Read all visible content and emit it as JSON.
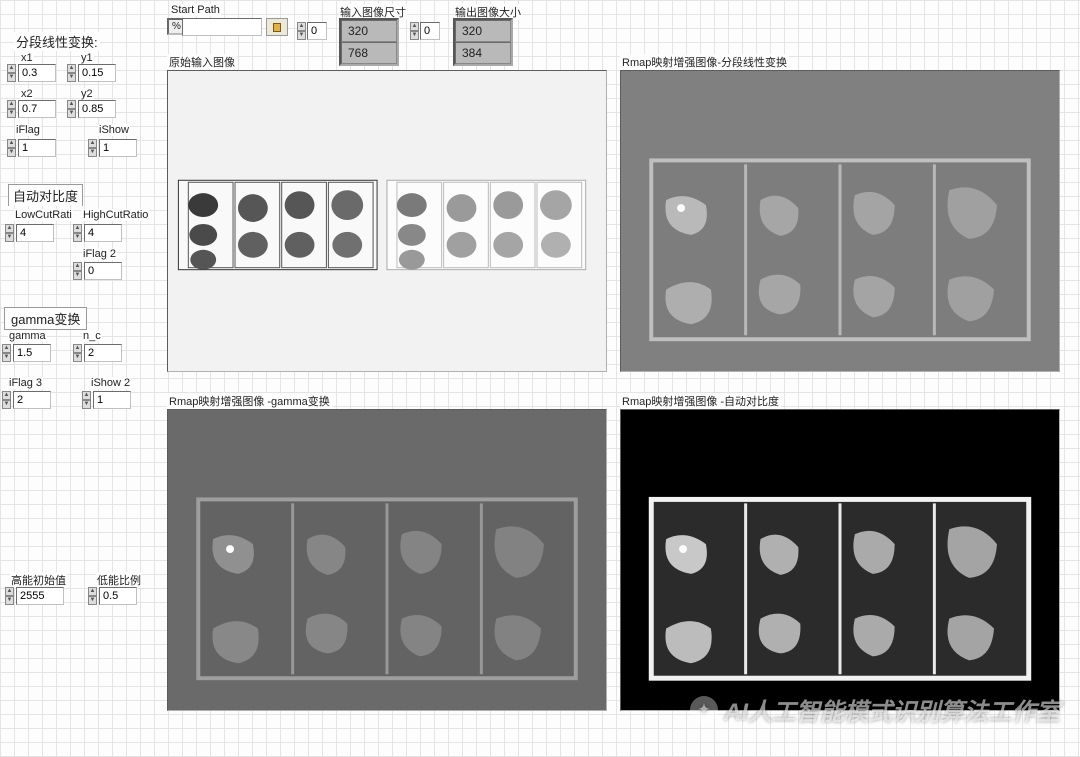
{
  "sections": {
    "piecewise": {
      "title": "分段线性变换:",
      "x1": {
        "label": "x1",
        "value": "0.3"
      },
      "y1": {
        "label": "y1",
        "value": "0.15"
      },
      "x2": {
        "label": "x2",
        "value": "0.7"
      },
      "y2": {
        "label": "y2",
        "value": "0.85"
      },
      "iFlag": {
        "label": "iFlag",
        "value": "1"
      },
      "iShow": {
        "label": "iShow",
        "value": "1"
      }
    },
    "autoContrast": {
      "title": "自动对比度",
      "lowCut": {
        "label": "LowCutRati",
        "value": "4"
      },
      "highCut": {
        "label": "HighCutRatio",
        "value": "4"
      },
      "iFlag2": {
        "label": "iFlag 2",
        "value": "0"
      }
    },
    "gammaTrans": {
      "title": "gamma变换",
      "gamma": {
        "label": "gamma",
        "value": "1.5"
      },
      "n_c": {
        "label": "n_c",
        "value": "2"
      },
      "iFlag3": {
        "label": "iFlag 3",
        "value": "2"
      },
      "iShow2": {
        "label": "iShow 2",
        "value": "1"
      }
    },
    "bottom": {
      "highInit": {
        "label": "高能初始值",
        "value": "2555"
      },
      "lowRatio": {
        "label": "低能比例",
        "value": "0.5"
      }
    }
  },
  "topBar": {
    "startPath": {
      "label": "Start Path",
      "value": "",
      "prefix": "%"
    },
    "smallSpin1": "0",
    "inputDim": {
      "label": "输入图像尺寸",
      "w": "320",
      "h": "768"
    },
    "smallSpin2": "0",
    "outputDim": {
      "label": "输出图像大小",
      "w": "320",
      "h": "384"
    }
  },
  "panels": {
    "orig": "原始输入图像",
    "gammaOut": "Rmap映射增强图像 -gamma变换",
    "pieceOut": "Rmap映射增强图像-分段线性变换",
    "autoOut": "Rmap映射增强图像 -自动对比度"
  },
  "watermark": "AI人工智能模式识别算法工作室"
}
